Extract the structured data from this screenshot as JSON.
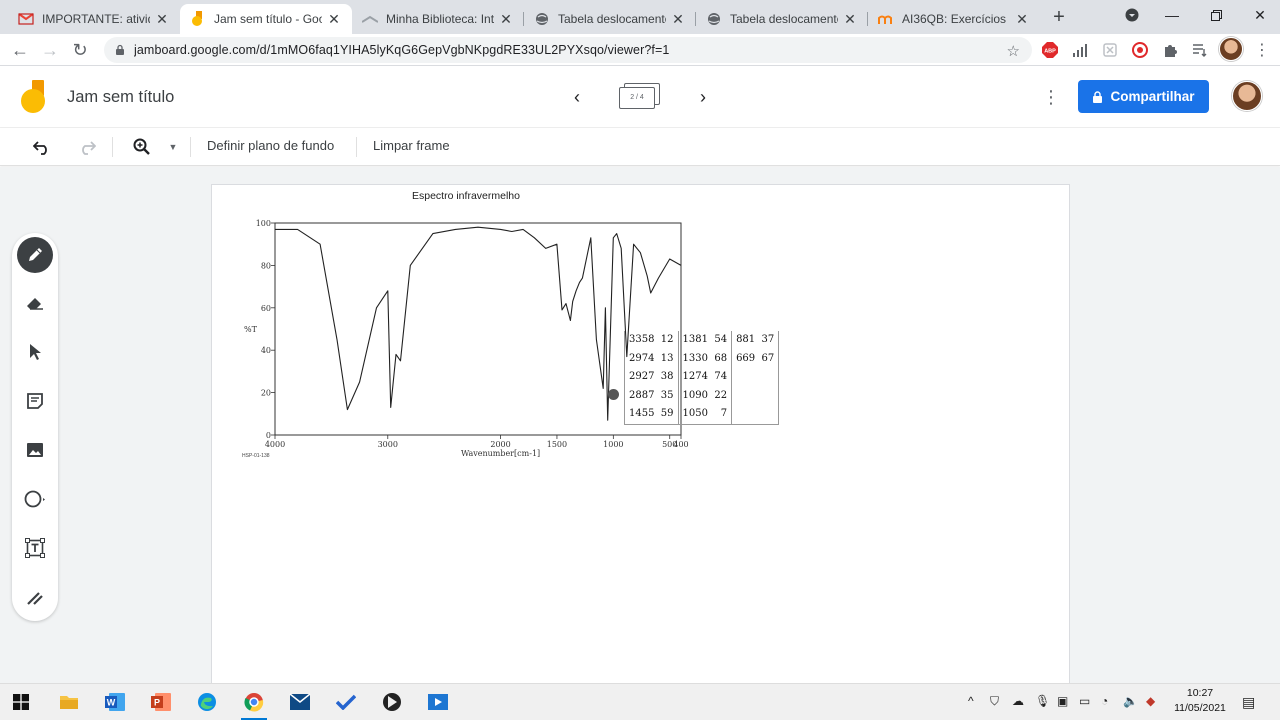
{
  "browser": {
    "tabs": [
      {
        "title": "IMPORTANTE: atividad",
        "favicon": "gmail-icon",
        "active": false
      },
      {
        "title": "Jam sem título - Goog",
        "favicon": "jamboard-icon",
        "active": true
      },
      {
        "title": "Minha Biblioteca: Intro",
        "favicon": "library-icon",
        "active": false
      },
      {
        "title": "Tabela deslocamento",
        "favicon": "globe-icon",
        "active": false
      },
      {
        "title": "Tabela deslocamento",
        "favicon": "globe-icon",
        "active": false
      },
      {
        "title": "AI36QB: Exercícios",
        "favicon": "moodle-icon",
        "active": false
      }
    ],
    "url": "jamboard.google.com/d/1mMO6faq1YIHA5lyKqG6GepVgbNKpgdRE33UL2PYXsqo/viewer?f=1"
  },
  "jam": {
    "title": "Jam sem título",
    "frame_indicator": "2 / 4",
    "share_label": "Compartilhar",
    "toolbar": {
      "background_label": "Definir plano de fundo",
      "clear_label": "Limpar frame"
    }
  },
  "slide": {
    "title": "Espectro infravermelho",
    "y_axis_label": "%T",
    "x_axis_label": "Wavenumber[cm-1]",
    "footer_code": "HSP-01-138",
    "x_ticks": [
      "4000",
      "3000",
      "2000",
      "1500",
      "1000",
      "500",
      "400"
    ],
    "y_ticks": [
      "100",
      "80",
      "60",
      "40",
      "20",
      "0"
    ],
    "peak_table": [
      [
        "3358  12",
        "1381  54",
        "881  37"
      ],
      [
        "2974  13",
        "1330  68",
        "669  67"
      ],
      [
        "2927  38",
        "1274  74",
        ""
      ],
      [
        "2887  35",
        "1090  22",
        ""
      ],
      [
        "1455  59",
        "1050    7",
        ""
      ]
    ]
  },
  "chart_data": {
    "type": "line",
    "title": "Espectro infravermelho",
    "xlabel": "Wavenumber[cm-1]",
    "ylabel": "%T",
    "xlim": [
      4000,
      400
    ],
    "ylim": [
      0,
      100
    ],
    "x": [
      4000,
      3800,
      3600,
      3450,
      3358,
      3250,
      3100,
      3000,
      2974,
      2927,
      2887,
      2800,
      2600,
      2400,
      2200,
      2000,
      1900,
      1800,
      1700,
      1600,
      1500,
      1455,
      1420,
      1381,
      1360,
      1330,
      1300,
      1274,
      1200,
      1150,
      1090,
      1070,
      1050,
      1000,
      970,
      930,
      881,
      820,
      760,
      700,
      669,
      600,
      500,
      400
    ],
    "series": [
      {
        "values": [
          97,
          97,
          90,
          45,
          12,
          25,
          60,
          68,
          13,
          38,
          35,
          80,
          95,
          97,
          98,
          97,
          96,
          97,
          93,
          88,
          90,
          59,
          62,
          54,
          63,
          68,
          72,
          74,
          93,
          45,
          22,
          60,
          7,
          93,
          95,
          88,
          37,
          90,
          86,
          75,
          67,
          74,
          83,
          80
        ]
      }
    ]
  },
  "taskbar": {
    "time": "10:27",
    "date": "11/05/2021"
  }
}
